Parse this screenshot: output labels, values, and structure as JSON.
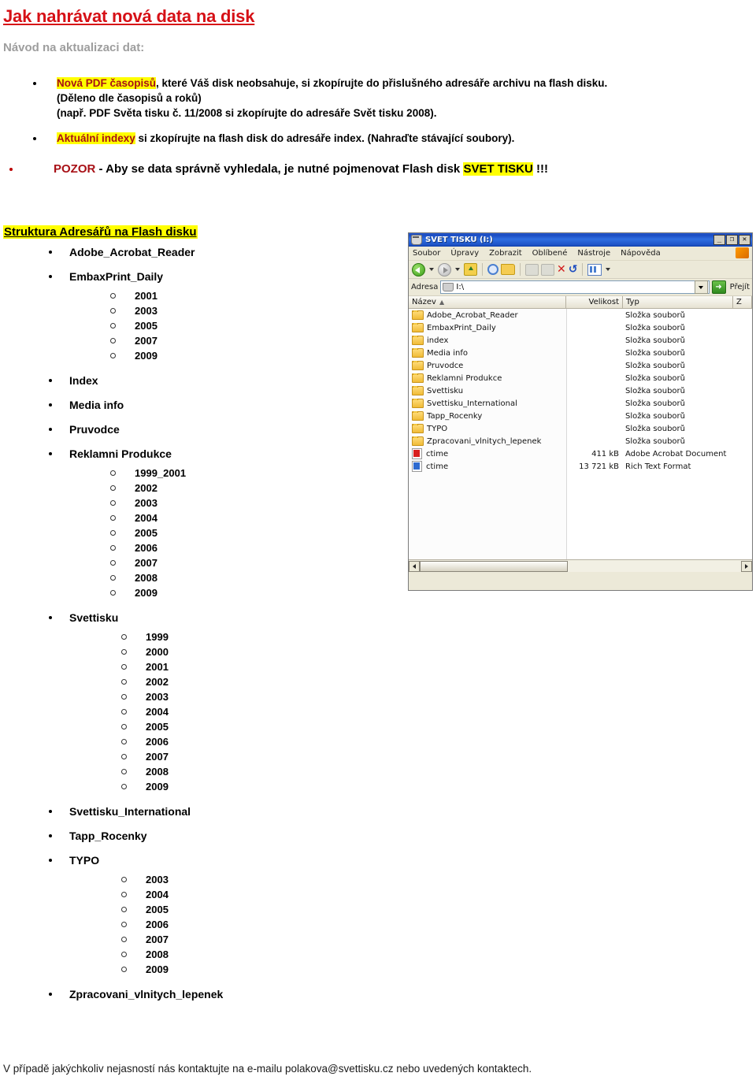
{
  "document": {
    "title": "Jak nahrávat nová data na disk",
    "subtitle": "Návod na aktualizaci dat:",
    "footer": "V případě jakýchkoliv nejasností nás kontaktujte na e-mailu polakova@svettisku.cz nebo uvedených kontaktech.",
    "colors": {
      "title_red": "#d61016",
      "dark_red": "#a81016",
      "highlight_yellow": "#ffff00",
      "subtitle_gray": "#9e9e9e"
    }
  },
  "instructions": [
    {
      "highlight": "Nová PDF časopisů",
      "rest": ", které Váš disk neobsahuje, si zkopírujte do přislušného adresáře archivu na flash disku.",
      "line2": "(Děleno dle časopisů a roků)",
      "line3": "(např. PDF Světa tisku č. 11/2008 si zkopírujte do adresáře Svět tisku 2008)."
    },
    {
      "highlight": "Aktuální indexy",
      "rest": " si zkopírujte na flash disk do adresáře index. (Nahraďte stávající soubory)."
    },
    {
      "warn": "POZOR",
      "mid": " - Aby se data správně vyhledala, je nutné pojmenovat  Flash disk ",
      "highlight": "SVET TISKU",
      "tail": "  !!!"
    }
  ],
  "structure": {
    "heading": "Struktura Adresářů na Flash disku",
    "items": [
      {
        "name": "Adobe_Acrobat_Reader",
        "children": []
      },
      {
        "name": "EmbaxPrint_Daily",
        "children": [
          "2001",
          "2003",
          "2005",
          "2007",
          "2009"
        ]
      },
      {
        "name": "Index",
        "children": []
      },
      {
        "name": "Media info",
        "children": []
      },
      {
        "name": "Pruvodce",
        "children": []
      },
      {
        "name": "Reklamni Produkce",
        "children": [
          "1999_2001",
          "2002",
          "2003",
          "2004",
          "2005",
          "2006",
          "2007",
          "2008",
          "2009"
        ]
      },
      {
        "name": "Svettisku",
        "children": [
          "1999",
          "2000",
          "2001",
          "2002",
          "2003",
          "2004",
          "2005",
          "2006",
          "2007",
          "2008",
          "2009"
        ]
      },
      {
        "name": "Svettisku_International",
        "children": []
      },
      {
        "name": "Tapp_Rocenky",
        "children": []
      },
      {
        "name": "TYPO",
        "children": [
          "2003",
          "2004",
          "2005",
          "2006",
          "2007",
          "2008",
          "2009"
        ]
      },
      {
        "name": "Zpracovani_vlnitych_lepenek",
        "children": []
      }
    ]
  },
  "explorer": {
    "title": "SVET TISKU (I:)",
    "window_buttons": {
      "minimize": "_",
      "maximize": "❐",
      "close": "✕"
    },
    "menu": [
      "Soubor",
      "Úpravy",
      "Zobrazit",
      "Oblíbené",
      "Nástroje",
      "Nápověda"
    ],
    "address_label": "Adresa",
    "address_value": "I:\\",
    "go_label": "Přejít",
    "columns": [
      "Název",
      "Velikost",
      "Typ",
      "Z"
    ],
    "sort_indicator": "▲",
    "rows": [
      {
        "name": "Adobe_Acrobat_Reader",
        "size": "",
        "type": "Složka souborů",
        "modified": "",
        "icon": "folder-icon"
      },
      {
        "name": "EmbaxPrint_Daily",
        "size": "",
        "type": "Složka souborů",
        "modified": "",
        "icon": "folder-icon"
      },
      {
        "name": "index",
        "size": "",
        "type": "Složka souborů",
        "modified": "",
        "icon": "folder-icon"
      },
      {
        "name": "Media info",
        "size": "",
        "type": "Složka souborů",
        "modified": "",
        "icon": "folder-icon"
      },
      {
        "name": "Pruvodce",
        "size": "",
        "type": "Složka souborů",
        "modified": "",
        "icon": "folder-icon"
      },
      {
        "name": "Reklamni Produkce",
        "size": "",
        "type": "Složka souborů",
        "modified": "",
        "icon": "folder-icon"
      },
      {
        "name": "Svettisku",
        "size": "",
        "type": "Složka souborů",
        "modified": "",
        "icon": "folder-icon"
      },
      {
        "name": "Svettisku_International",
        "size": "",
        "type": "Složka souborů",
        "modified": "",
        "icon": "folder-icon"
      },
      {
        "name": "Tapp_Rocenky",
        "size": "",
        "type": "Složka souborů",
        "modified": "",
        "icon": "folder-icon"
      },
      {
        "name": "TYPO",
        "size": "",
        "type": "Složka souborů",
        "modified": "",
        "icon": "folder-icon"
      },
      {
        "name": "Zpracovani_vlnitych_lepenek",
        "size": "",
        "type": "Složka souborů",
        "modified": "",
        "icon": "folder-icon"
      },
      {
        "name": "ctime",
        "size": "411 kB",
        "type": "Adobe Acrobat Document",
        "modified": "",
        "icon": "pdf-file-icon"
      },
      {
        "name": "ctime",
        "size": "13 721 kB",
        "type": "Rich Text Format",
        "modified": "",
        "icon": "rtf-file-icon"
      }
    ]
  }
}
